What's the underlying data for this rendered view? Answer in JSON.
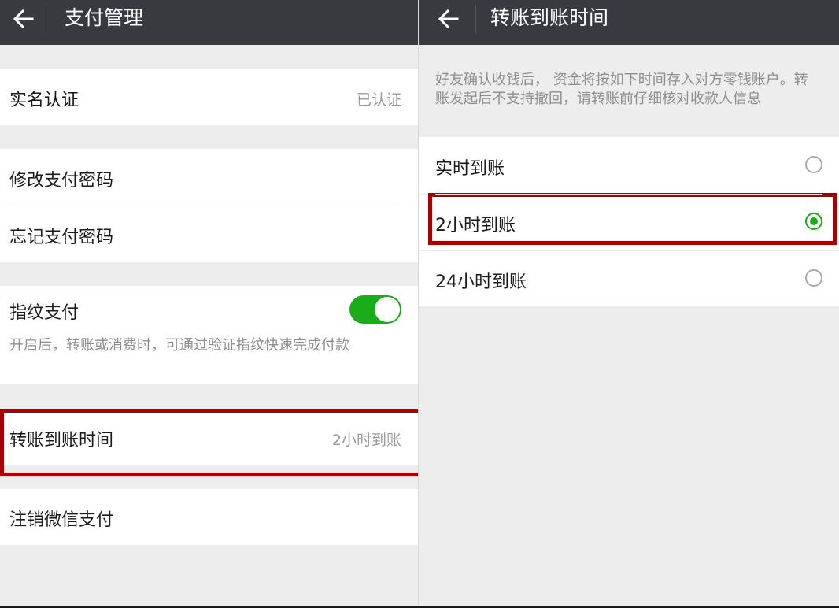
{
  "colors": {
    "topbar_bg": "#393a3f",
    "accent_green": "#1aad19",
    "highlight_red": "#a80000",
    "page_bg": "#ededed"
  },
  "left": {
    "title": "支付管理",
    "realname": {
      "label": "实名认证",
      "value": "已认证"
    },
    "change_password": {
      "label": "修改支付密码"
    },
    "forgot_password": {
      "label": "忘记支付密码"
    },
    "fingerprint": {
      "label": "指纹支付",
      "enabled": true,
      "description": "开启后，转账或消费时，可通过验证指纹快速完成付款"
    },
    "transfer_time": {
      "label": "转账到账时间",
      "value": "2小时到账"
    },
    "cancel_pay": {
      "label": "注销微信支付"
    }
  },
  "right": {
    "title": "转账到账时间",
    "notice": "好友确认收钱后， 资金将按如下时间存入对方零钱账户。转账发起后不支持撤回，请转账前仔细核对收款人信息",
    "options": [
      {
        "label": "实时到账",
        "selected": false
      },
      {
        "label": "2小时到账",
        "selected": true
      },
      {
        "label": "24小时到账",
        "selected": false
      }
    ]
  }
}
